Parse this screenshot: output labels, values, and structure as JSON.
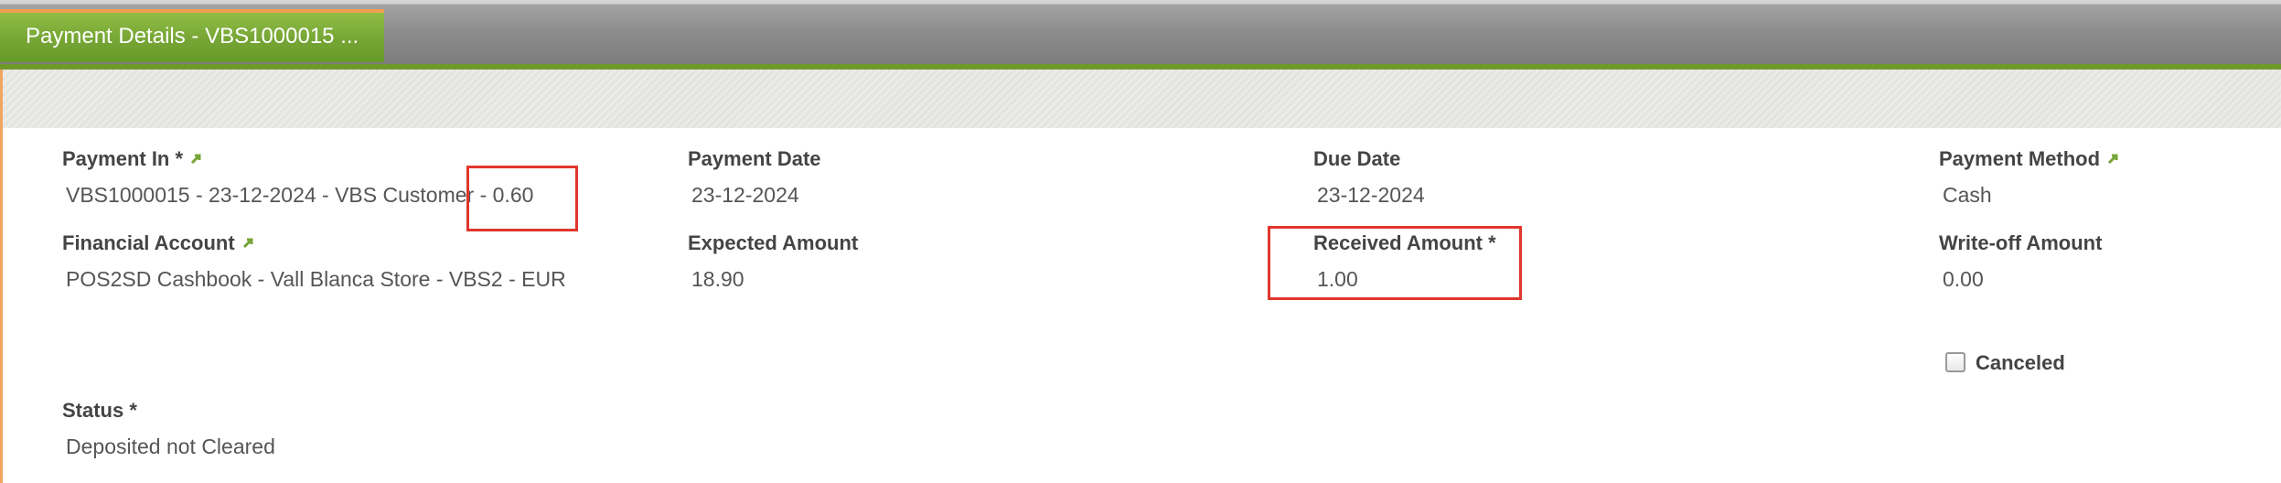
{
  "tab": {
    "title": "Payment Details - VBS1000015 ..."
  },
  "fields": {
    "payment_in": {
      "label": "Payment In *",
      "value": "VBS1000015 - 23-12-2024 - VBS Customer - 0.60"
    },
    "payment_date": {
      "label": "Payment Date",
      "value": "23-12-2024"
    },
    "due_date": {
      "label": "Due Date",
      "value": "23-12-2024"
    },
    "payment_method": {
      "label": "Payment Method",
      "value": "Cash"
    },
    "financial_account": {
      "label": "Financial Account",
      "value": "POS2SD Cashbook - Vall Blanca Store - VBS2 - EUR"
    },
    "expected_amount": {
      "label": "Expected Amount",
      "value": "18.90"
    },
    "received_amount": {
      "label": "Received Amount *",
      "value": "1.00"
    },
    "writeoff_amount": {
      "label": "Write-off Amount",
      "value": "0.00"
    },
    "canceled": {
      "label": "Canceled",
      "checked": false
    },
    "status": {
      "label": "Status *",
      "value": "Deposited not Cleared"
    }
  },
  "colors": {
    "accent_green": "#76a535",
    "tab_top": "#f0a050",
    "highlight": "#e0372c"
  },
  "icons": {
    "link": "link-arrow-icon",
    "checkbox": "checkbox-icon"
  }
}
